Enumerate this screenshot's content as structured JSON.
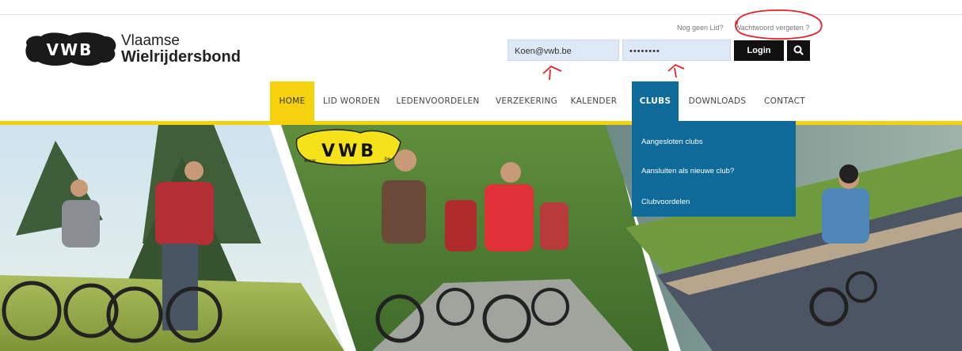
{
  "brand": {
    "logo_text": "VWB",
    "line1": "Vlaamse",
    "line2": "Wielrijdersbond"
  },
  "toplinks": {
    "not_member": "Nog geen Lid?",
    "forgot_password": "Wachtwoord vergeten ?"
  },
  "login": {
    "email_value": "Koen@vwb.be",
    "password_value": "••••••••",
    "login_label": "Login"
  },
  "nav": {
    "items": [
      {
        "label": "HOME"
      },
      {
        "label": "LID WORDEN"
      },
      {
        "label": "LEDENVOORDELEN"
      },
      {
        "label": "VERZEKERING"
      },
      {
        "label": "KALENDER"
      },
      {
        "label": "CLUBS"
      },
      {
        "label": "DOWNLOADS"
      },
      {
        "label": "CONTACT"
      }
    ]
  },
  "dropdown": {
    "items": [
      {
        "label": "Aangesloten clubs"
      },
      {
        "label": "Aansluiten als nieuwe club?"
      },
      {
        "label": "Clubvoordelen"
      }
    ]
  },
  "hero": {
    "sign_text": "VWB",
    "sign_small_left": "www.",
    "sign_small_right": ".be"
  },
  "colors": {
    "accent_yellow": "#f5d20d",
    "clubs_blue": "#0e6a98",
    "annotation_red": "#e0252a"
  }
}
